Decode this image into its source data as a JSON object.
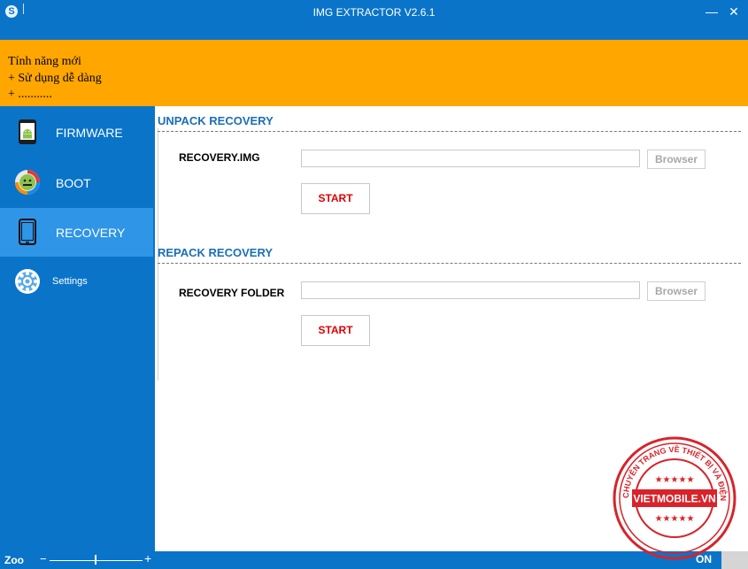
{
  "window": {
    "title": "IMG EXTRACTOR V2.6.1",
    "app_icon_letter": "S",
    "minimize": "—",
    "close": "✕"
  },
  "notice": {
    "lines": [
      "Tính năng mới",
      "+ Sử dụng dễ dàng",
      "+ ..........."
    ]
  },
  "sidebar": {
    "items": [
      {
        "label": "FIRMWARE",
        "icon": "android-phone-icon",
        "active": false
      },
      {
        "label": "BOOT",
        "icon": "boot-android-icon",
        "active": false
      },
      {
        "label": "RECOVERY",
        "icon": "tablet-icon",
        "active": true
      },
      {
        "label": "Settings",
        "icon": "gear-icon",
        "active": false
      }
    ]
  },
  "unpack": {
    "title": "UNPACK RECOVERY",
    "field_label": "RECOVERY.IMG",
    "value": "",
    "browse": "Browser",
    "start": "START"
  },
  "repack": {
    "title": "REPACK RECOVERY",
    "field_label": "RECOVERY FOLDER",
    "value": "",
    "browse": "Browser",
    "start": "START"
  },
  "statusbar": {
    "zoom_label": "Zoo",
    "zoom_minus": "−",
    "zoom_plus": "+",
    "on_label": "ON"
  },
  "watermark": {
    "text_top": "CHUYÊN TRANG VỀ THIẾT BỊ VÀ ĐIỆN THOẠI",
    "brand": "VIETMOBILE.VN"
  },
  "colors": {
    "primary": "#0a74c9",
    "active": "#2f95e6",
    "notice": "#ffa600",
    "section_title": "#1a6fb8",
    "start_text": "#e00000",
    "stamp": "#d8232a"
  }
}
